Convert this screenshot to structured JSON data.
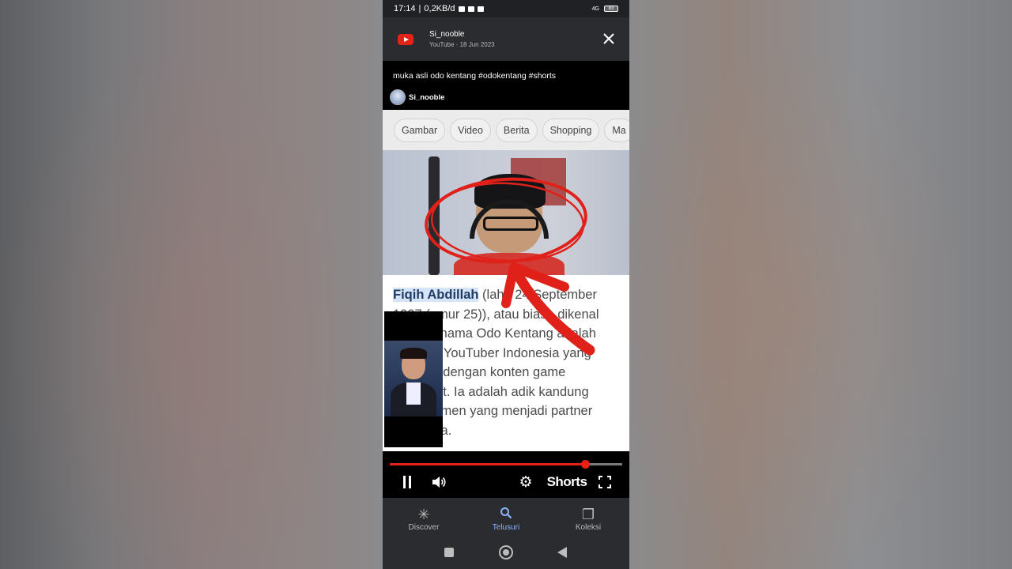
{
  "status_bar": {
    "time": "17:14",
    "speed": "0,2KB/d",
    "network": "4G",
    "battery": "83"
  },
  "app_bar": {
    "title": "Si_nooble",
    "source": "YouTube",
    "separator": "·",
    "date": "18 Jun 2023"
  },
  "video": {
    "title": "muka asli odo kentang #odokentang #shorts",
    "channel": "Si_nooble",
    "progress": 0.84
  },
  "search_chips": [
    "Gambar",
    "Video",
    "Berita",
    "Shopping",
    "Ma"
  ],
  "wiki_snippet": {
    "highlight": "Fiqih Abdillah",
    "lines": [
      " (lahir 24 September",
      "1997 (umur 25)), atau biasa dikenal",
      "dengan nama Odo Kentang adalah",
      "seorang YouTuber Indonesia yang",
      "terkenal dengan konten game",
      "Minecraft. Ia adalah adik kandung",
      "pebisnismen yang menjadi partner",
      "kakaknya."
    ]
  },
  "controls": {
    "shorts_label": "Shorts"
  },
  "bottom_nav": [
    {
      "label": "Discover",
      "icon": "discover-icon",
      "glyph": "✳"
    },
    {
      "label": "Telusuri",
      "icon": "search-icon",
      "glyph": "⚲"
    },
    {
      "label": "Koleksi",
      "icon": "collection-icon",
      "glyph": "❐"
    }
  ],
  "colors": {
    "accent": "#e62117",
    "nav_active": "#8ab4f8",
    "highlight_bg": "#d6e4f7"
  }
}
